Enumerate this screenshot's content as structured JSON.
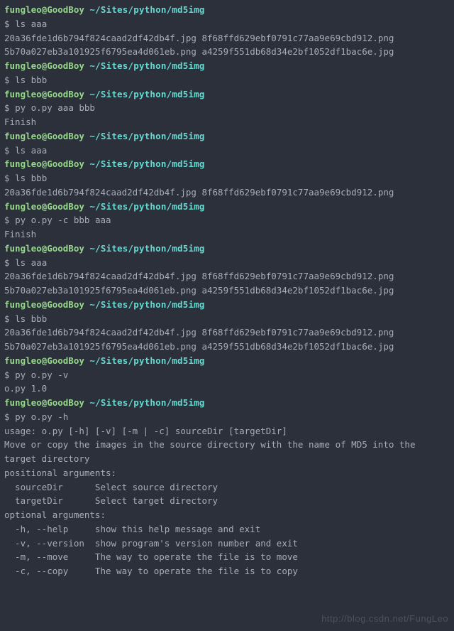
{
  "prompt": {
    "user": "fungleo@GoodBoy",
    "path": "~/Sites/python/md5img",
    "symbol": "$"
  },
  "files": {
    "col1_row1": "20a36fde1d6b794f824caad2df42db4f.jpg",
    "col2_row1": "8f68ffd629ebf0791c77aa9e69cbd912.png",
    "col1_row2": "5b70a027eb3a101925f6795ea4d061eb.png",
    "col2_row2": "a4259f551db68d34e2bf1052df1bac6e.jpg"
  },
  "commands": {
    "ls_aaa": "ls aaa",
    "ls_bbb": "ls bbb",
    "py_aaa_bbb": "py o.py aaa bbb",
    "py_c_bbb_aaa": "py o.py -c bbb aaa",
    "py_v": "py o.py -v",
    "py_h": "py o.py -h"
  },
  "outputs": {
    "finish": "Finish",
    "version": "o.py 1.0"
  },
  "help": {
    "usage": "usage: o.py [-h] [-v] [-m | -c] sourceDir [targetDir]",
    "blank": "",
    "desc1": "Move or copy the images in the source directory with the name of MD5 into the",
    "desc2": "target directory",
    "pos_header": "positional arguments:",
    "pos_source": "  sourceDir      Select source directory",
    "pos_target": "  targetDir      Select target directory",
    "opt_header": "optional arguments:",
    "opt_h": "  -h, --help     show this help message and exit",
    "opt_v": "  -v, --version  show program's version number and exit",
    "opt_m": "  -m, --move     The way to operate the file is to move",
    "opt_c": "  -c, --copy     The way to operate the file is to copy"
  },
  "watermark": "http://blog.csdn.net/FungLeo"
}
